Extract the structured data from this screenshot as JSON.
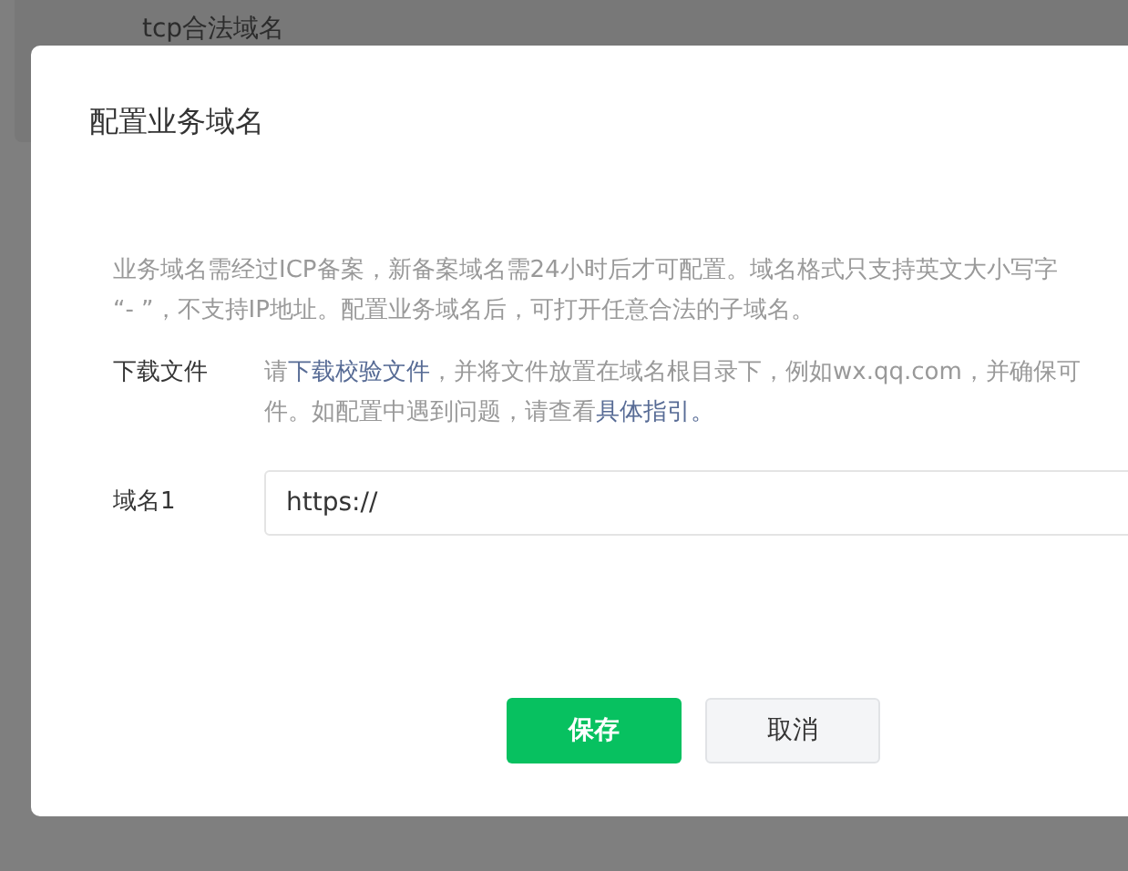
{
  "background": {
    "section_title": "tcp合法域名"
  },
  "dialog": {
    "title": "配置业务域名",
    "notice": [
      "业务域名需经过ICP备案，新备案域名需24小时后才可配置。域名格式只支持英文大小写字",
      "“- ”，不支持IP地址。配置业务域名后，可打开任意合法的子域名。"
    ],
    "download": {
      "label": "下载文件",
      "line1_before": "请",
      "link": "下载校验文件",
      "line1_after": "，并将文件放置在域名根目录下，例如wx.qq.com，并确保可",
      "line2_before": "件。如配置中遇到问题，请查看",
      "guide_link": "具体指引。"
    },
    "domain_field": {
      "label": "域名1",
      "value": "https://"
    },
    "buttons": [
      {
        "label": "保存",
        "kind": "primary"
      },
      {
        "label": "取消",
        "kind": "secondary"
      }
    ]
  }
}
